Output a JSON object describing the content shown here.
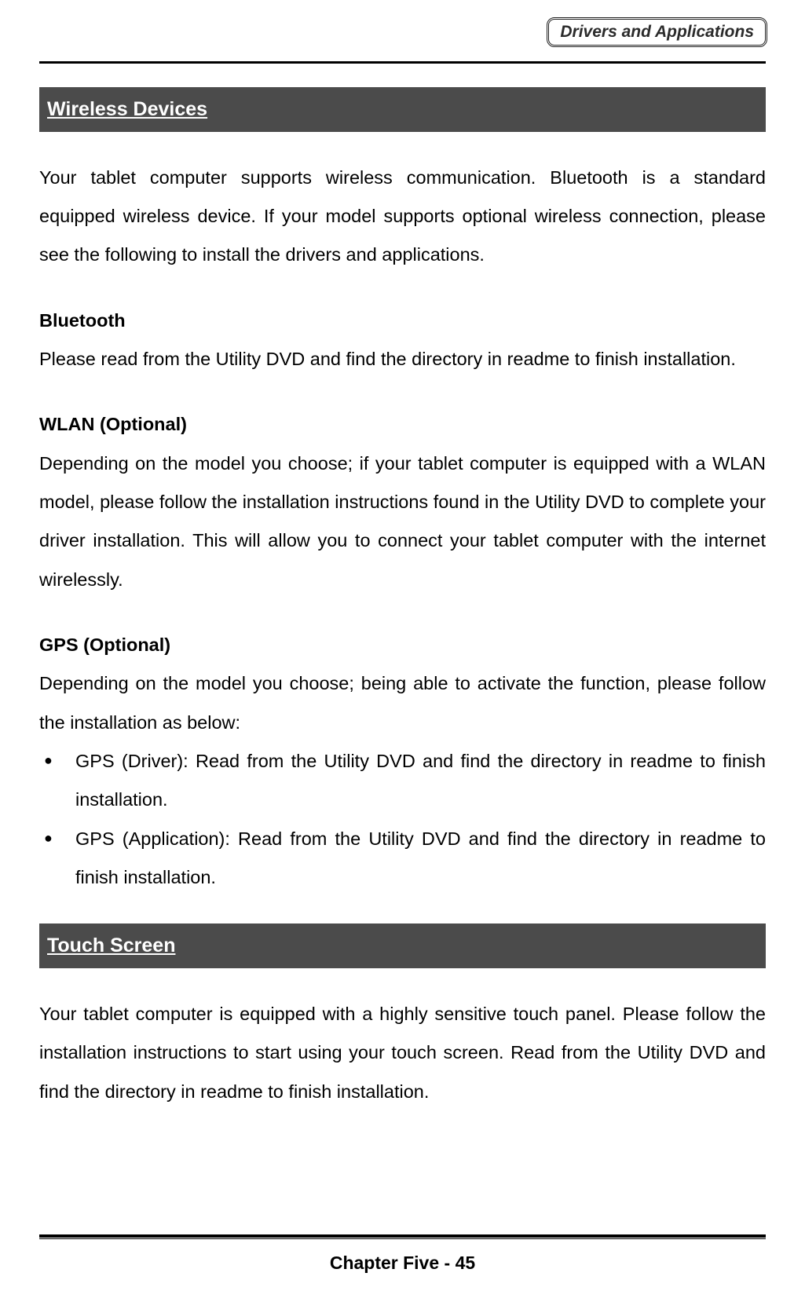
{
  "header": {
    "badge": "Drivers and Applications"
  },
  "section1": {
    "title": " Wireless Devices",
    "intro": "Your tablet computer supports wireless communication. Bluetooth is a standard equipped wireless device. If your model supports optional wireless connection, please see the following to install the drivers and applications.",
    "bluetooth": {
      "heading": "Bluetooth",
      "text": "Please read from the Utility DVD and find the directory in readme to finish installation."
    },
    "wlan": {
      "heading": "WLAN (Optional)",
      "text": "Depending on the model you choose; if your tablet computer is equipped with a WLAN model, please follow the installation instructions found in the Utility DVD to complete your driver installation. This will allow you to connect your tablet computer with the internet wirelessly."
    },
    "gps": {
      "heading": "GPS (Optional)",
      "intro": "Depending on the model you choose; being able to activate the function, please follow the installation as below:",
      "items": [
        "GPS (Driver): Read from the Utility DVD and find the directory in readme to finish installation.",
        "GPS (Application): Read from the Utility DVD and find the directory in readme to finish installation."
      ]
    }
  },
  "section2": {
    "title": " Touch Screen",
    "text": "Your tablet computer is equipped with a highly sensitive touch panel. Please follow the installation instructions to start using your touch screen. Read from the Utility DVD and find the directory in readme to finish installation."
  },
  "footer": {
    "text": "Chapter Five - 45"
  }
}
